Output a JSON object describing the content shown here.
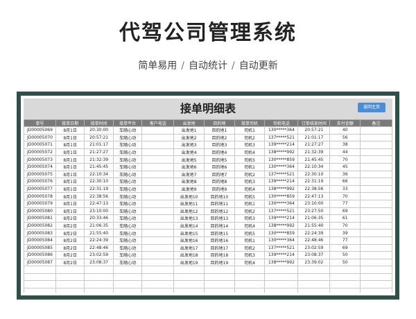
{
  "headline": "代驾公司管理系统",
  "subline": [
    "简单易用",
    "自动统计",
    "自动更新"
  ],
  "subline_separator": "/",
  "sheet": {
    "title": "接单明细表",
    "back_button": "返回主页",
    "columns": [
      "单号",
      "接单日期",
      "接单时间",
      "接单平台",
      "客户电话",
      "出发地",
      "目的地",
      "接单司机",
      "司机电话",
      "订单结束时间",
      "支付金额",
      "备注"
    ],
    "rows": [
      [
        "JD00005069",
        "8月1日",
        "20:30:00",
        "车随心动",
        "",
        "出发地1",
        "目的地1",
        "司机1",
        "130*****364",
        "20:57:21",
        "40",
        ""
      ],
      [
        "JD00005070",
        "8月1日",
        "20:57:21",
        "车随心动",
        "",
        "出发地2",
        "目的地2",
        "司机2",
        "137*****521",
        "21:01:17",
        "56",
        ""
      ],
      [
        "JD00005071",
        "8月1日",
        "21:01:17",
        "车随心动",
        "",
        "出发地3",
        "目的地3",
        "司机3",
        "139*****214",
        "21:27:27",
        "38",
        ""
      ],
      [
        "JD00005072",
        "8月1日",
        "21:27:27",
        "车随心动",
        "",
        "出发地4",
        "目的地4",
        "司机4",
        "138*****992",
        "21:32:39",
        "44",
        ""
      ],
      [
        "JD00005073",
        "8月1日",
        "21:32:39",
        "车随心动",
        "",
        "出发地5",
        "目的地5",
        "司机5",
        "130*****859",
        "21:45:45",
        "70",
        ""
      ],
      [
        "JD00005074",
        "8月1日",
        "21:45:45",
        "车随心动",
        "",
        "出发地6",
        "目的地6",
        "司机1",
        "130*****364",
        "22:10:34",
        "45",
        ""
      ],
      [
        "JD00005075",
        "8月1日",
        "22:10:34",
        "车随心动",
        "",
        "出发地7",
        "目的地7",
        "司机2",
        "137*****521",
        "22:30:10",
        "36",
        ""
      ],
      [
        "JD00005076",
        "8月1日",
        "22:30:10",
        "车随心动",
        "",
        "出发地8",
        "目的地8",
        "司机3",
        "139*****214",
        "22:31:19",
        "66",
        ""
      ],
      [
        "JD00005077",
        "8月1日",
        "22:31:19",
        "车随心动",
        "",
        "出发地9",
        "目的地9",
        "司机4",
        "138*****992",
        "22:38:56",
        "33",
        ""
      ],
      [
        "JD00005078",
        "8月1日",
        "22:38:56",
        "车随心动",
        "",
        "出发地10",
        "目的地10",
        "司机5",
        "130*****859",
        "22:47:13",
        "70",
        ""
      ],
      [
        "JD00005079",
        "8月1日",
        "22:47:13",
        "车随心动",
        "",
        "出发地11",
        "目的地11",
        "司机1",
        "130*****364",
        "23:10:00",
        "77",
        ""
      ],
      [
        "JD00005080",
        "8月1日",
        "23:10:00",
        "车随心动",
        "",
        "出发地12",
        "目的地12",
        "司机2",
        "137*****521",
        "23:27:50",
        "69",
        ""
      ],
      [
        "JD00005081",
        "8月2日",
        "20:33:46",
        "车随心动",
        "",
        "出发地13",
        "目的地13",
        "司机3",
        "139*****214",
        "21:06:35",
        "61",
        ""
      ],
      [
        "JD00005082",
        "8月2日",
        "21:06:35",
        "车随心动",
        "",
        "出发地14",
        "目的地14",
        "司机4",
        "138*****992",
        "21:55:40",
        "70",
        ""
      ],
      [
        "JD00005083",
        "8月2日",
        "21:55:40",
        "车随心动",
        "",
        "出发地15",
        "目的地15",
        "司机5",
        "130*****859",
        "22:24:39",
        "39",
        ""
      ],
      [
        "JD00005084",
        "8月2日",
        "22:24:39",
        "车随心动",
        "",
        "出发地16",
        "目的地16",
        "司机1",
        "130*****364",
        "22:48:46",
        "77",
        ""
      ],
      [
        "JD00005085",
        "8月2日",
        "22:48:46",
        "车随心动",
        "",
        "出发地17",
        "目的地17",
        "司机2",
        "137*****521",
        "23:02:59",
        "69",
        ""
      ],
      [
        "JD00005086",
        "8月2日",
        "23:02:59",
        "车随心动",
        "",
        "出发地18",
        "目的地18",
        "司机3",
        "139*****214",
        "23:08:37",
        "50",
        ""
      ],
      [
        "JD00005087",
        "8月2日",
        "23:08:37",
        "车随心动",
        "",
        "出发地19",
        "目的地19",
        "司机4",
        "138*****992",
        "23:39:02",
        "50",
        ""
      ]
    ],
    "colors": {
      "frame": "#2f4f49",
      "header": "#7a7a7a",
      "button": "#4a8fd6"
    }
  }
}
